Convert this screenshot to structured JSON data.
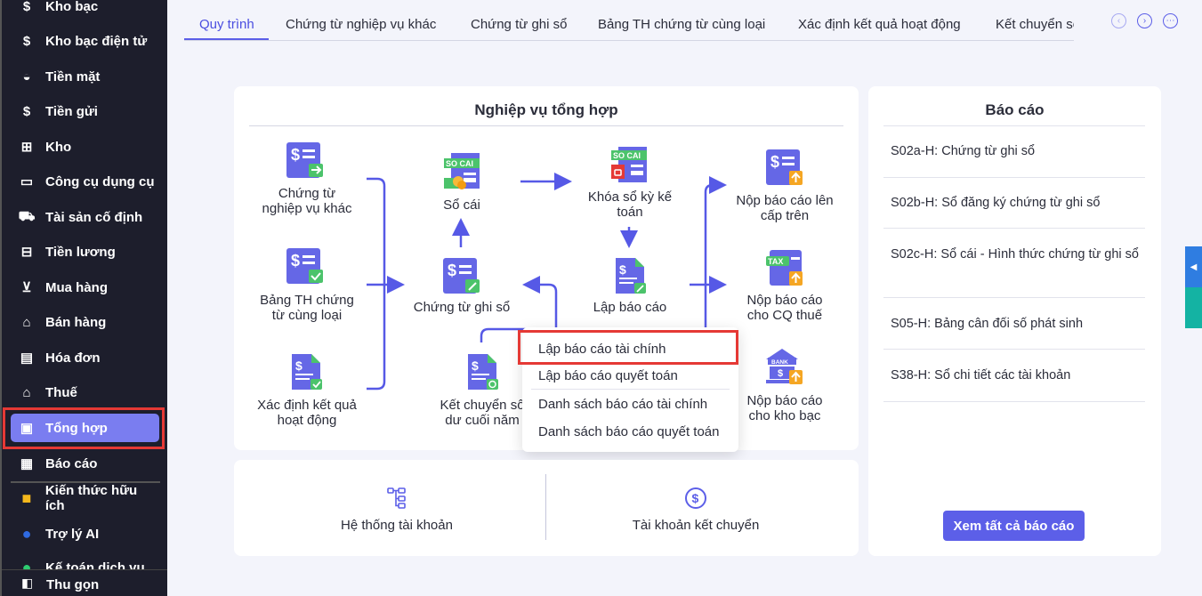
{
  "sidebar": {
    "items": [
      {
        "label": "Kho bạc",
        "icon": "dollar-icon"
      },
      {
        "label": "Kho bạc điện tử",
        "icon": "e-treasury-icon"
      },
      {
        "label": "Tiền mặt",
        "icon": "cash-icon"
      },
      {
        "label": "Tiền gửi",
        "icon": "deposit-icon"
      },
      {
        "label": "Kho",
        "icon": "warehouse-icon"
      },
      {
        "label": "Công cụ dụng cụ",
        "icon": "tools-icon"
      },
      {
        "label": "Tài sản cố định",
        "icon": "truck-icon"
      },
      {
        "label": "Tiền lương",
        "icon": "briefcase-icon"
      },
      {
        "label": "Mua hàng",
        "icon": "cart-icon"
      },
      {
        "label": "Bán hàng",
        "icon": "store-icon"
      },
      {
        "label": "Hóa đơn",
        "icon": "invoice-icon"
      },
      {
        "label": "Thuế",
        "icon": "bank-icon"
      },
      {
        "label": "Tổng hợp",
        "icon": "ledger-icon",
        "active": true
      },
      {
        "label": "Báo cáo",
        "icon": "chart-icon"
      },
      {
        "label": "Kiến thức hữu ích",
        "icon": "book-icon"
      },
      {
        "label": "Trợ lý AI",
        "icon": "robot-icon"
      },
      {
        "label": "Kế toán dịch vụ",
        "icon": "service-icon"
      }
    ],
    "collapse": "Thu gọn"
  },
  "tabs": [
    "Quy trình",
    "Chứng từ nghiệp vụ khác",
    "Chứng từ ghi sổ",
    "Bảng TH chứng từ cùng loại",
    "Xác định kết quả hoạt động",
    "Kết chuyển số dư cuối năm"
  ],
  "flow": {
    "title": "Nghiệp vụ tổng hợp",
    "nodes": {
      "ctnvk": [
        "Chứng từ",
        "nghiệp vụ khác"
      ],
      "bangth": [
        "Bảng TH chứng",
        "từ cùng loại"
      ],
      "xdkq": [
        "Xác định kết quả",
        "hoạt động"
      ],
      "socai": [
        "Sổ cái"
      ],
      "ctgs": [
        "Chứng từ ghi sổ"
      ],
      "ketchuyen": [
        "Kết chuyển số",
        "dư cuối năm"
      ],
      "khoaso": [
        "Khóa sổ kỳ kế",
        "toán"
      ],
      "lapbc": [
        "Lập báo cáo"
      ],
      "noptren": [
        "Nộp báo cáo lên",
        "cấp trên"
      ],
      "nopthue": [
        "Nộp báo cáo",
        "cho CQ thuế"
      ],
      "nopkb": [
        "Nộp báo cáo",
        "cho kho bạc"
      ]
    },
    "icon_text": {
      "socai": "SO CAI",
      "tax": "TAX",
      "bank": "BANK"
    },
    "menu": [
      "Lập báo cáo tài chính",
      "Lập báo cáo quyết toán",
      "Danh sách báo cáo tài chính",
      "Danh sách báo cáo quyết toán"
    ]
  },
  "shortcuts": [
    "Hệ thống tài khoản",
    "Tài khoản kết chuyển"
  ],
  "reports": {
    "title": "Báo cáo",
    "items": [
      "S02a-H: Chứng từ ghi sổ",
      "S02b-H: Sổ đăng ký chứng từ ghi sổ",
      "S02c-H: Sổ cái - Hình thức chứng từ ghi sổ",
      "S05-H: Bảng cân đối số phát sinh",
      "S38-H: Sổ chi tiết các tài khoản"
    ],
    "view_all": "Xem tất cả báo cáo"
  },
  "colors": {
    "accent": "#5c5fe8",
    "sidebar": "#1d1e2c",
    "highlight": "#e53935"
  }
}
